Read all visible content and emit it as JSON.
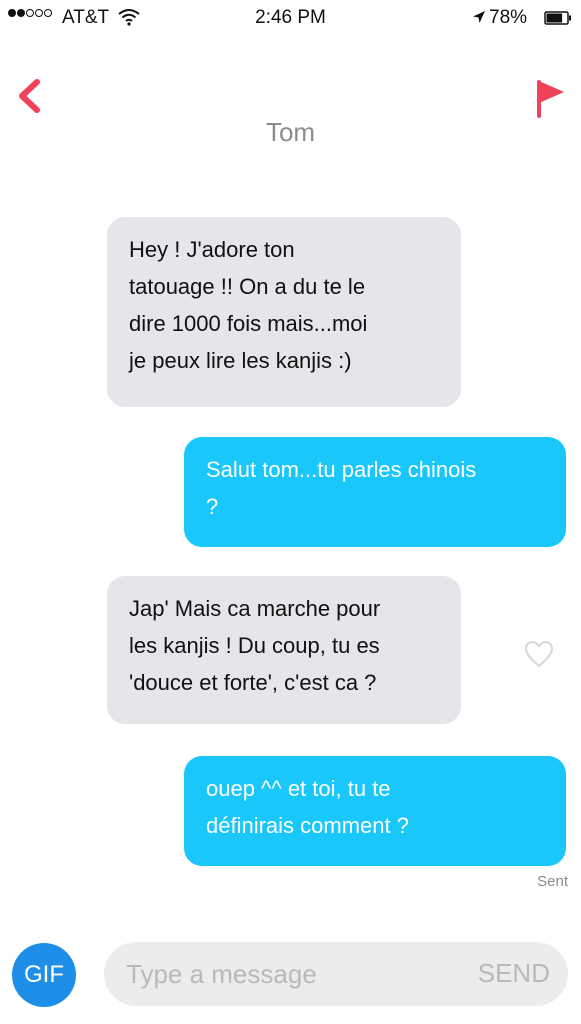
{
  "status_bar": {
    "signal_dots": [
      "full",
      "full",
      "empty",
      "empty",
      "empty"
    ],
    "carrier": "AT&T",
    "wifi_icon": "wifi-icon",
    "time": "2:46 PM",
    "location_icon": "location-arrow-icon",
    "battery_percent": "78%",
    "battery_level": 0.78,
    "battery_icon": "battery-icon"
  },
  "header": {
    "back_icon": "chevron-left-icon",
    "contact_name": "Tom",
    "flag_icon": "flag-icon",
    "accent_color": "#f0435a"
  },
  "messages": [
    {
      "direction": "received",
      "lines": [
        "Hey ! J'adore ton",
        "tatouage !! On a du te le",
        "dire 1000 fois mais...moi",
        "je peux lire les kanjis :)"
      ]
    },
    {
      "direction": "sent",
      "lines": [
        "Salut tom...tu parles chinois",
        "?"
      ]
    },
    {
      "direction": "received",
      "lines": [
        "Jap' Mais ca marche pour",
        "les kanjis ! Du coup, tu es",
        "'douce et forte', c'est ca ?"
      ],
      "like_icon": "heart-outline-icon"
    },
    {
      "direction": "sent",
      "lines": [
        "ouep ^^ et toi, tu te",
        "définirais comment ?"
      ]
    }
  ],
  "sent_status": "Sent",
  "composer": {
    "gif_label": "GIF",
    "placeholder": "Type a message",
    "send_label": "SEND"
  },
  "colors": {
    "sent_bubble": "#19c7fb",
    "received_bubble": "#e5e5ea",
    "gif_button": "#1e8fe8"
  }
}
